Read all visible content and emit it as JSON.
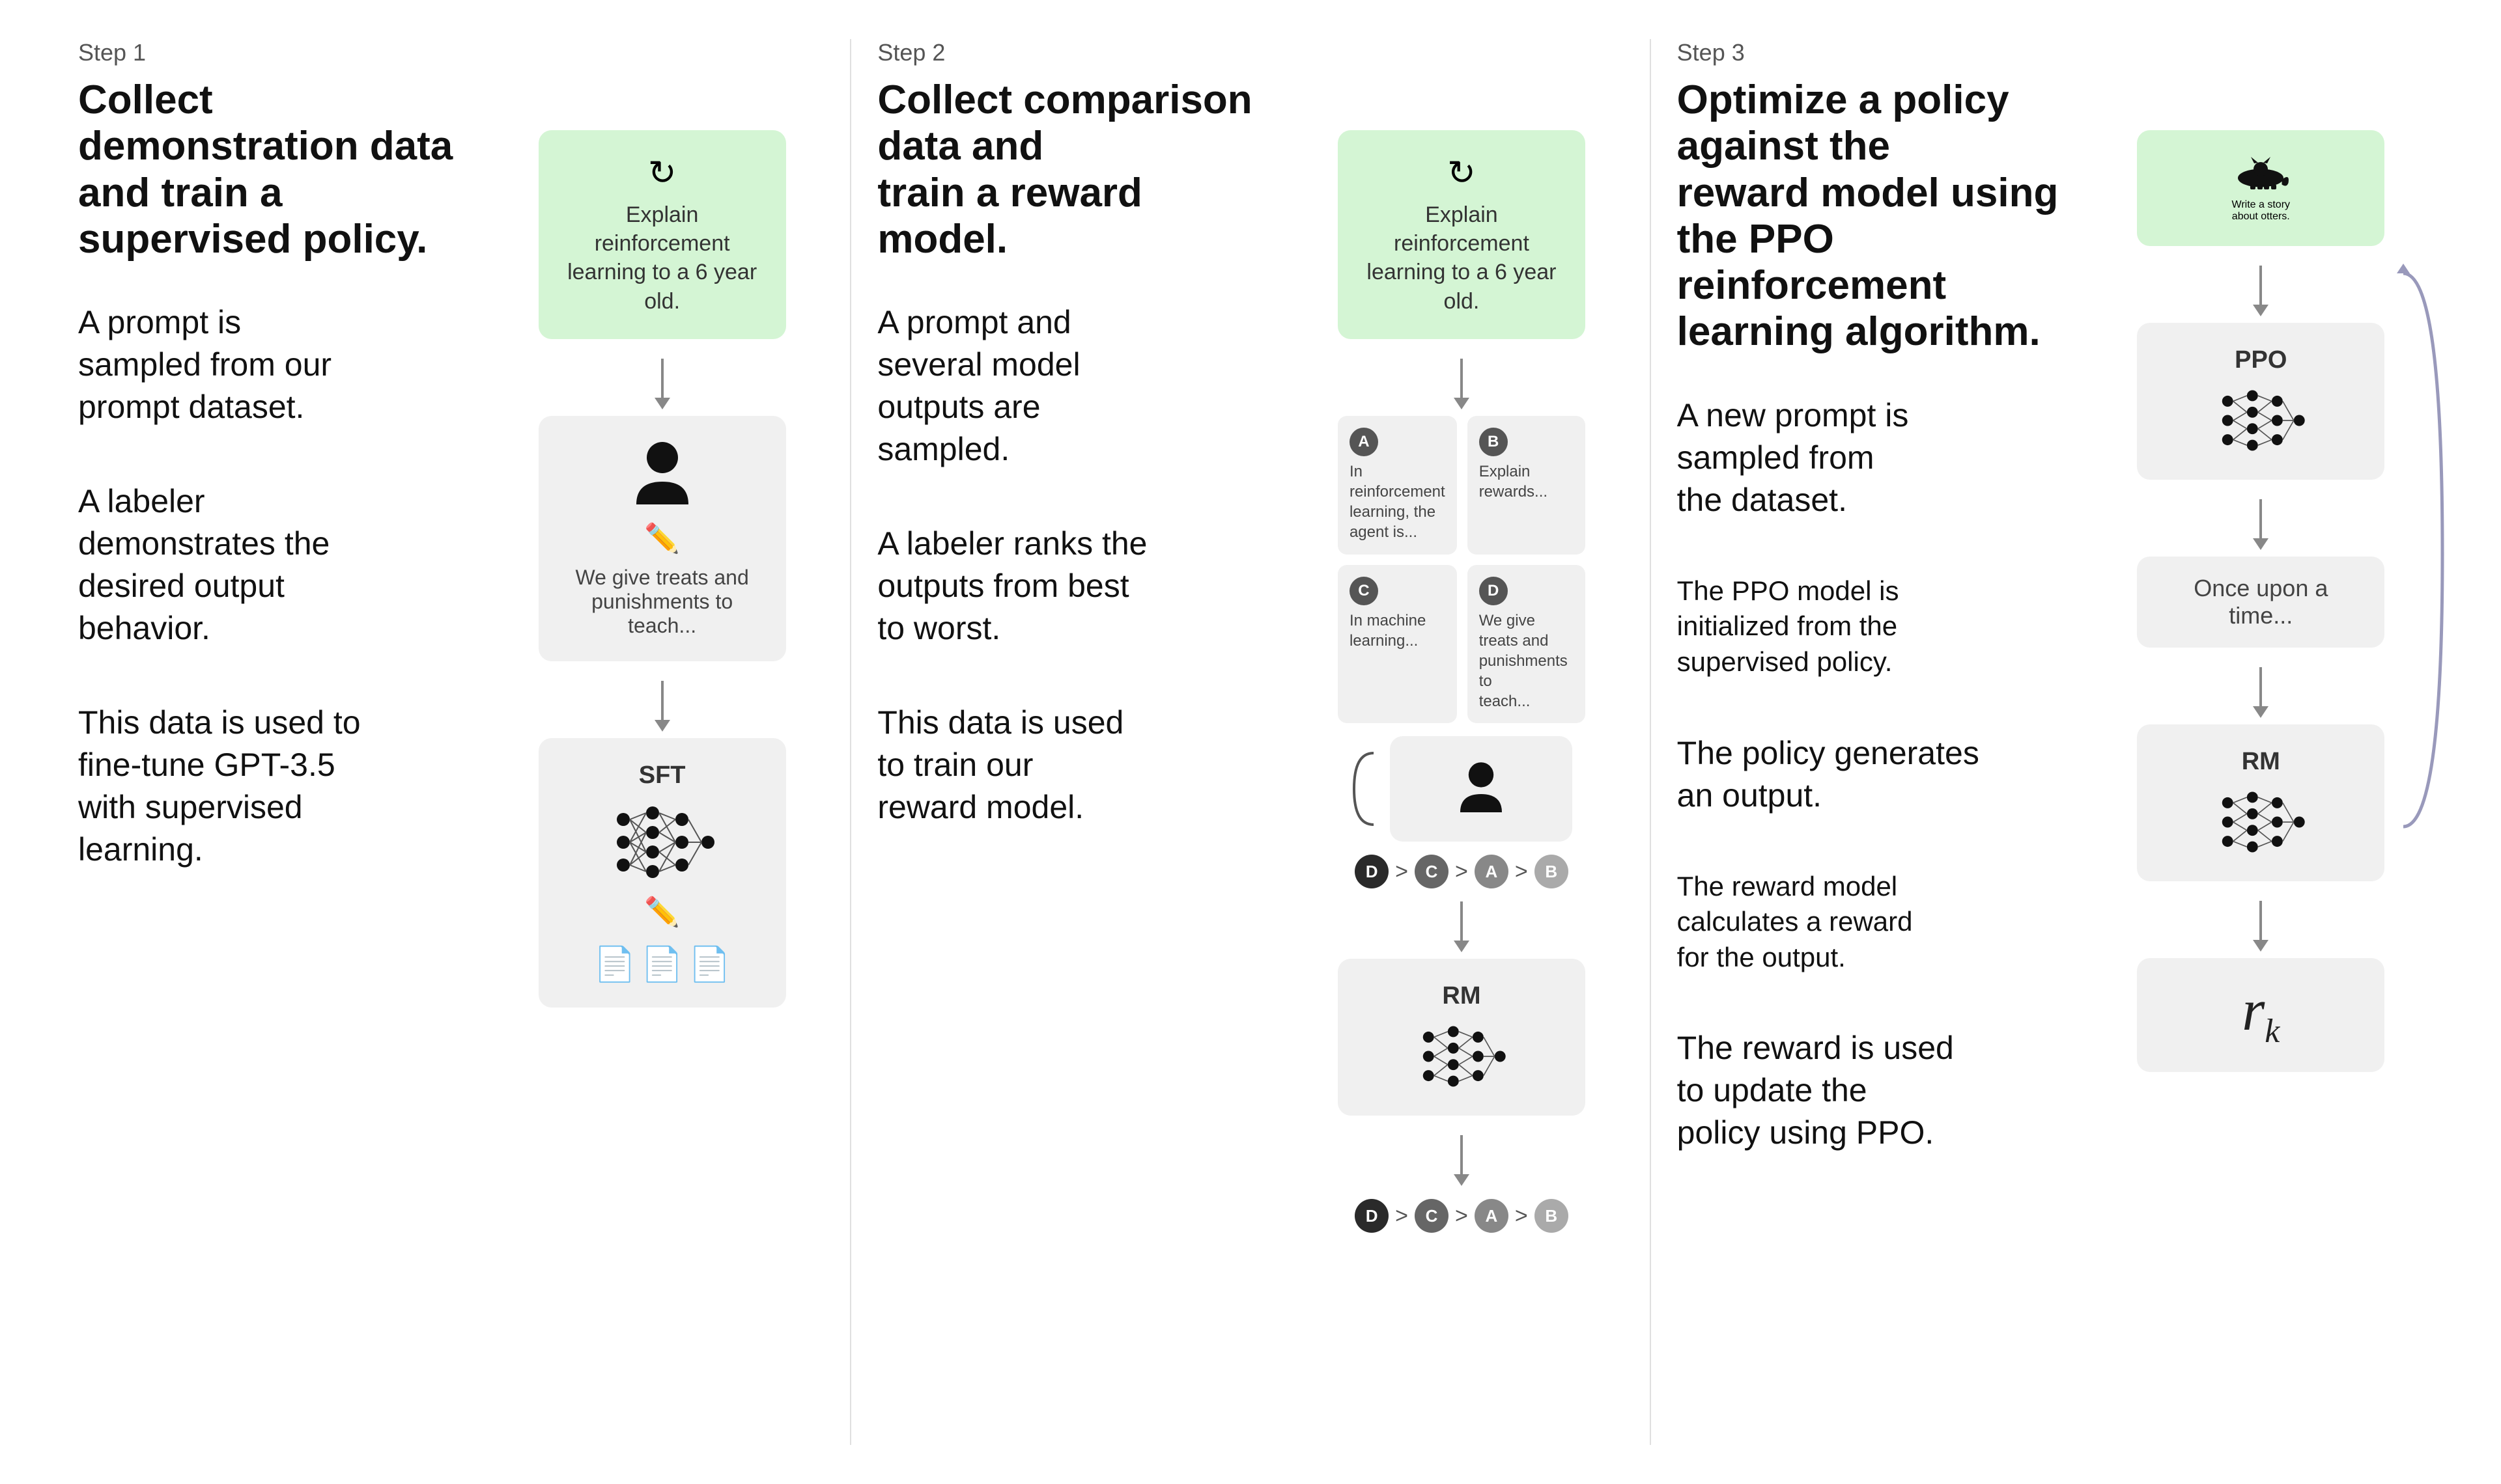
{
  "steps": [
    {
      "id": "step1",
      "step_label": "Step 1",
      "title": "Collect demonstration data\nand train a supervised policy.",
      "text_blocks": [
        "A prompt is\nsampled from our\nprompt dataset.",
        "A labeler\ndemonstrates the\ndesired output\nbehavior.",
        "This data is used to\nfine-tune GPT-3.5\nwith supervised\nlearning."
      ],
      "prompt_box": {
        "text": "Explain reinforcement\nlearning to a 6 year old."
      },
      "labeler_box": {
        "subtext": "We give treats and\npunishments to teach..."
      },
      "sft_label": "SFT"
    },
    {
      "id": "step2",
      "step_label": "Step 2",
      "title": "Collect comparison data and\ntrain a reward model.",
      "text_blocks": [
        "A prompt and\nseveral model\noutputs are\nsampled.",
        "A labeler ranks the\noutputs from best\nto worst.",
        "This data is used\nto train our\nreward model."
      ],
      "prompt_box": {
        "text": "Explain reinforcement\nlearning to a 6 year old."
      },
      "output_cards": [
        {
          "letter": "A",
          "text": "In reinforcement\nlearning, the\nagent is..."
        },
        {
          "letter": "B",
          "text": "Explain rewards..."
        },
        {
          "letter": "C",
          "text": "In machine\nlearning..."
        },
        {
          "letter": "D",
          "text": "We give treats and\npunishments to\nteach..."
        }
      ],
      "ranking": [
        "D",
        "C",
        "A",
        "B"
      ],
      "rm_label": "RM"
    },
    {
      "id": "step3",
      "step_label": "Step 3",
      "title": "Optimize a policy against the\nreward model using the PPO\nreinforcement learning algorithm.",
      "text_blocks": [
        "A new prompt is\nsampled from\nthe dataset.",
        "The PPO model is\ninitialized from the\nsupervised policy.",
        "The policy generates\nan output.",
        "The reward model\ncalculates a reward\nfor the output.",
        "The reward is used\nto update the\npolicy using PPO."
      ],
      "prompt_box": {
        "text": "Write a story\nabout otters."
      },
      "ppo_label": "PPO",
      "output_text": "Once upon a time...",
      "rm_label": "RM",
      "reward_symbol": "r",
      "reward_subscript": "k"
    }
  ],
  "icons": {
    "recycle": "↻",
    "person": "👤",
    "pencil": "✏",
    "document": "📄",
    "arrow_down": "↓",
    "greater_than": ">"
  }
}
